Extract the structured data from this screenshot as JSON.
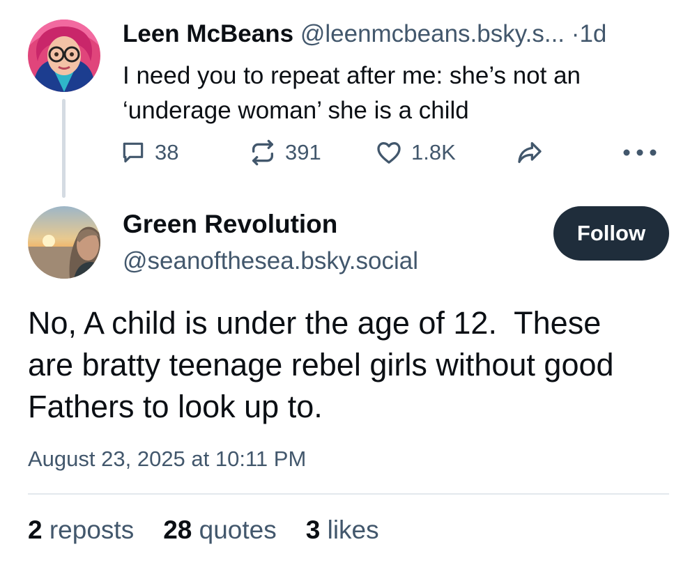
{
  "parent_post": {
    "author_name": "Leen McBeans",
    "handle": "@leenmcbeans.bsky.s...",
    "separator": "·",
    "time_ago": "1d",
    "text_line1": "I need you to repeat after me: she’s not an",
    "text_line2": "‘underage woman’ she is a child",
    "actions": {
      "reply_count": "38",
      "repost_count": "391",
      "like_count": "1.8K"
    },
    "icons": {
      "reply": "reply-icon",
      "repost": "repost-icon",
      "like": "heart-icon",
      "share": "share-icon",
      "more": "more-icon"
    }
  },
  "main_post": {
    "author_name": "Green Revolution",
    "handle": "@seanofthesea.bsky.social",
    "follow_label": "Follow",
    "text_line1": "No, A child is under the age of 12.  These",
    "text_line2": "are bratty teenage rebel girls without good",
    "text_line3": "Fathers to look up to.",
    "timestamp": "August 23, 2025 at 10:11 PM",
    "stats": {
      "reposts_count": "2",
      "reposts_label": "reposts",
      "quotes_count": "28",
      "quotes_label": "quotes",
      "likes_count": "3",
      "likes_label": "likes"
    }
  },
  "colors": {
    "text_primary": "#0b0f14",
    "text_secondary": "#42576c",
    "follow_button_bg": "#1f2d3b",
    "thread_line": "#d4dbe2",
    "divider": "#e3e8ed"
  }
}
